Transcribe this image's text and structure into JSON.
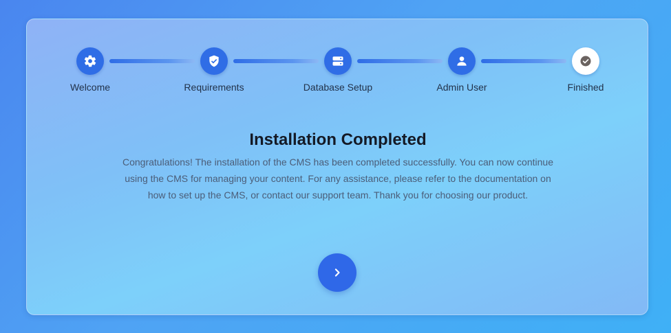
{
  "stepper": {
    "steps": [
      {
        "label": "Welcome",
        "icon": "gear-icon",
        "state": "complete"
      },
      {
        "label": "Requirements",
        "icon": "shield-check-icon",
        "state": "complete"
      },
      {
        "label": "Database Setup",
        "icon": "database-server-icon",
        "state": "complete"
      },
      {
        "label": "Admin User",
        "icon": "user-icon",
        "state": "complete"
      },
      {
        "label": "Finished",
        "icon": "check-circle-icon",
        "state": "current"
      }
    ]
  },
  "main": {
    "title": "Installation Completed",
    "message": "Congratulations! The installation of the CMS has been completed successfully. You can now continue using the CMS for managing your content. For any assistance, please refer to the documentation on how to set up the CMS, or contact our support team. Thank you for choosing our product.",
    "next_icon": "chevron-right-icon"
  },
  "colors": {
    "accent": "#2f6de6",
    "title": "#141a26",
    "body_text": "#4b5d78"
  }
}
